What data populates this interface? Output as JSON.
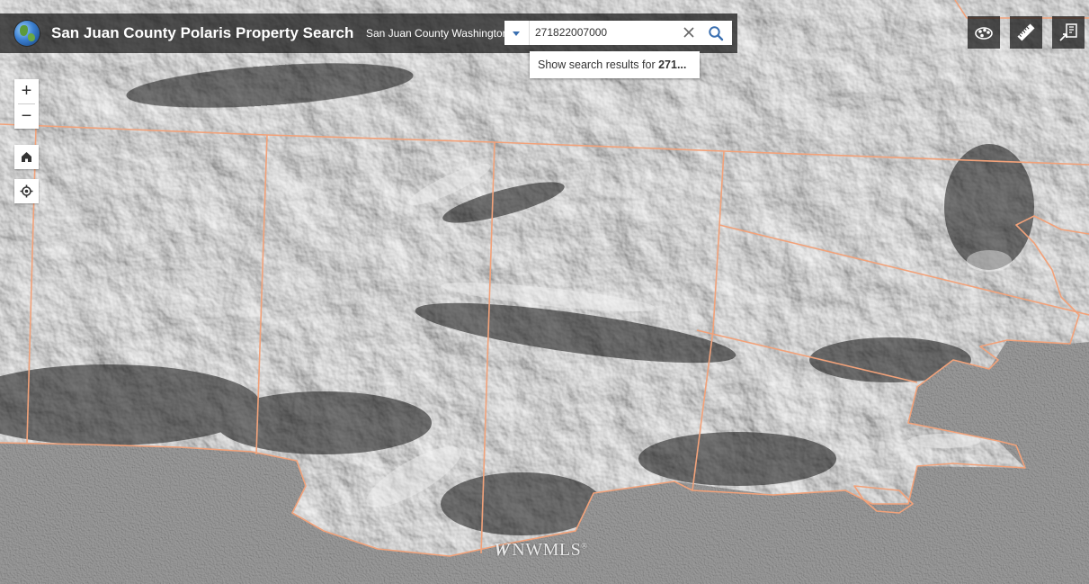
{
  "header": {
    "title": "San Juan County Polaris Property Search",
    "subtitle": "San Juan County Washington"
  },
  "search": {
    "value": "271822007000",
    "suggestion_prefix": "Show search results for ",
    "suggestion_term": "271...",
    "clear_icon": "close-icon",
    "search_icon": "search-icon"
  },
  "map_controls": {
    "zoom_in_label": "+",
    "zoom_out_label": "−",
    "home_icon": "home-icon",
    "locate_icon": "locate-icon"
  },
  "tools": {
    "basemap_icon": "basemap-gallery-icon",
    "measure_icon": "ruler-icon",
    "print_icon": "layers-icon"
  },
  "attribution": {
    "mark": "W",
    "text": "NWMLS",
    "symbol": "®"
  },
  "colors": {
    "parcel_line": "#f2a27a",
    "header_bg": "#141414",
    "accent": "#3a6fb0"
  }
}
